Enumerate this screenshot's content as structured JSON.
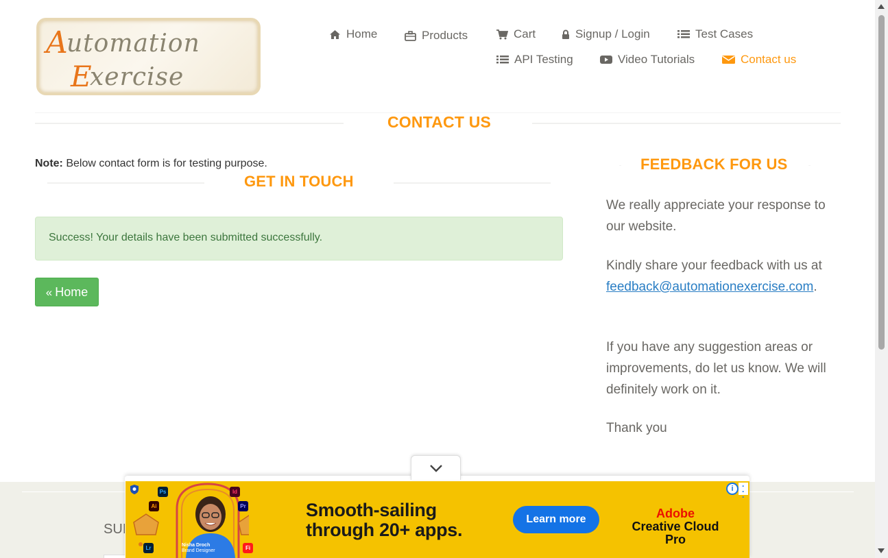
{
  "site": {
    "logo": {
      "line1": "Automation",
      "line2": "Exercise"
    }
  },
  "nav": {
    "home": "Home",
    "products": "Products",
    "cart": "Cart",
    "signup_login": "Signup / Login",
    "test_cases": "Test Cases",
    "api_testing": "API Testing",
    "video_tutorials": "Video Tutorials",
    "contact_us": "Contact us"
  },
  "colors": {
    "accent": "#fe980f",
    "success_bg": "#dff0d8",
    "success_text": "#3c763d",
    "button_green": "#5cb85c"
  },
  "contact": {
    "title": "CONTACT US",
    "note_label": "Note:",
    "note_text": " Below contact form is for testing purpose.",
    "get_in_touch": "GET IN TOUCH",
    "success_message": "Success! Your details have been submitted successfully.",
    "home_button": "Home"
  },
  "feedback": {
    "title": "FEEDBACK FOR US",
    "p1": "We really appreciate your response to our website.",
    "p2_before": "Kindly share your feedback with us at ",
    "p2_email": "feedback@automationexercise.com",
    "p2_after": ".",
    "p3": "If you have any suggestion areas or improvements, do let us know. We will definitely work on it.",
    "p4": "Thank you"
  },
  "footer": {
    "subscription_partial": "SUI"
  },
  "ad": {
    "headline_line1": "Smooth-sailing",
    "headline_line2": "through 20+ apps.",
    "cta": "Learn more",
    "brand_line1": "Adobe",
    "brand_line2": "Creative Cloud Pro",
    "person_name": "Nisha Droch",
    "person_role": "Brand Designer",
    "apps": [
      "Ps",
      "Ai",
      "Lr",
      "Id",
      "Pr",
      "Fi"
    ]
  }
}
